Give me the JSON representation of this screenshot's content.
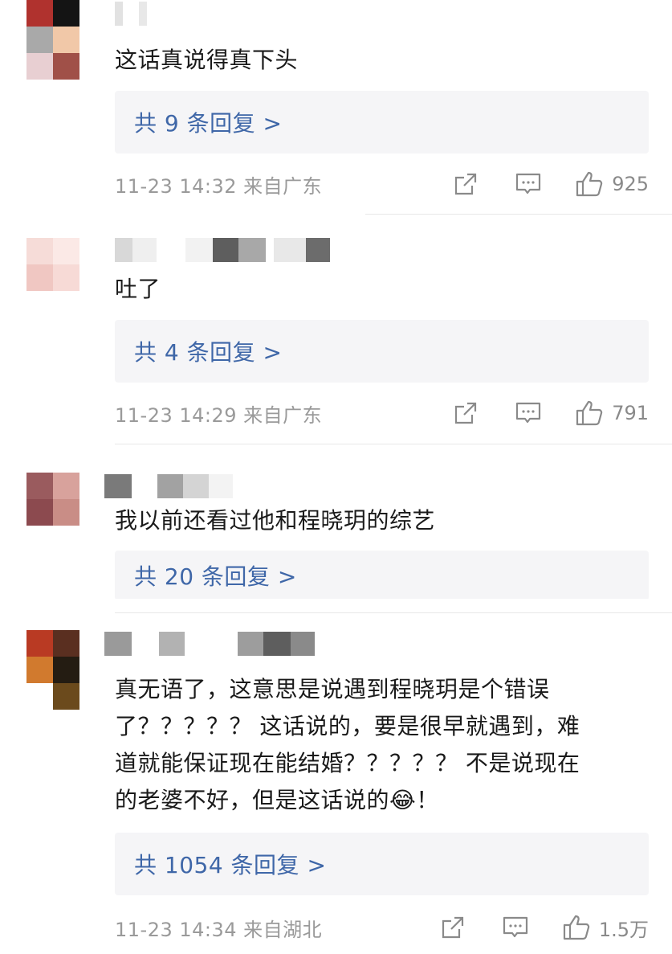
{
  "comments": [
    {
      "text": "这话真说得真下头",
      "reply_label": "共 9 条回复 >",
      "time": "11-23 14:32 来自广东",
      "likes": "925"
    },
    {
      "text": "吐了",
      "reply_label": "共 4 条回复 >",
      "time": "11-23 14:29 来自广东",
      "likes": "791"
    },
    {
      "text": "我以前还看过他和程晓玥的综艺",
      "reply_label": "共 20 条回复 >"
    },
    {
      "text_lines": [
        "真无语了，这意思是说遇到程晓玥是个错误",
        "了？？？？？ 这话说的，要是很早就遇到，难",
        "道就能保证现在能结婚？？？？？ 不是说现在",
        "的老婆不好，但是这话说的😂！"
      ],
      "reply_label": "共 1054 条回复 >",
      "time": "11-23 14:34 来自湖北",
      "likes": "1.5万"
    }
  ],
  "icons": {
    "share": "share-icon",
    "comment": "comment-icon",
    "like": "like-icon"
  },
  "colors": {
    "link": "#3f67a8",
    "meta": "#9a9a9a",
    "reply_bg": "#f5f5f7"
  }
}
